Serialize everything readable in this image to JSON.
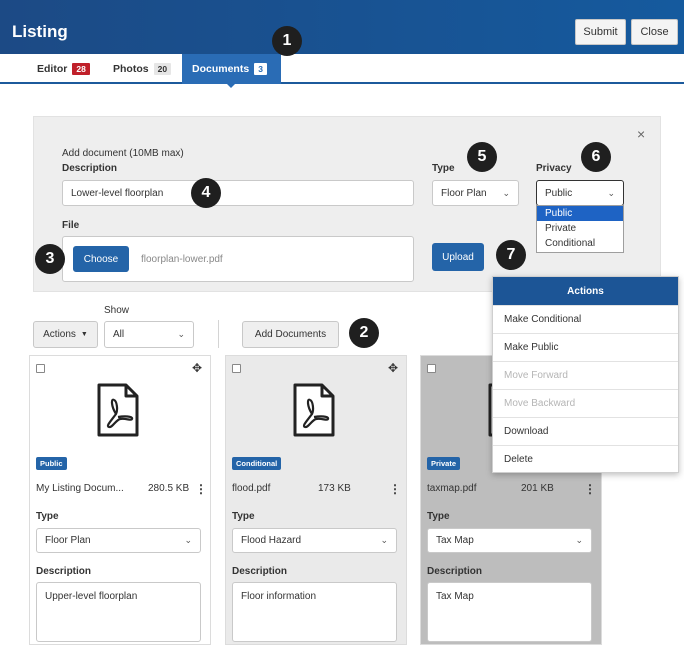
{
  "header": {
    "title": "Listing",
    "submit_label": "Submit",
    "close_label": "Close"
  },
  "tabs": [
    {
      "label": "Editor",
      "count": "28"
    },
    {
      "label": "Photos",
      "count": "20"
    },
    {
      "label": "Documents",
      "count": "3"
    }
  ],
  "callouts": [
    "1",
    "2",
    "3",
    "4",
    "5",
    "6",
    "7"
  ],
  "add_panel": {
    "close_glyph": "×",
    "heading": "Add document (10MB max)",
    "description_label": "Description",
    "description_value": "Lower-level floorplan",
    "file_label": "File",
    "choose_label": "Choose",
    "file_name": "floorplan-lower.pdf",
    "type_label": "Type",
    "type_value": "Floor Plan",
    "privacy_label": "Privacy",
    "privacy_value": "Public",
    "privacy_options": [
      "Public",
      "Private",
      "Conditional"
    ],
    "upload_label": "Upload"
  },
  "toolbar": {
    "show_label": "Show",
    "actions_label": "Actions",
    "show_value": "All",
    "add_documents_label": "Add Documents"
  },
  "actions_menu": {
    "title": "Actions",
    "items": [
      "Make Conditional",
      "Make Public",
      "Move Forward",
      "Move Backward",
      "Download",
      "Delete"
    ]
  },
  "documents": [
    {
      "badge": "Public",
      "name": "My Listing Docum...",
      "size": "280.5 KB",
      "type_label": "Type",
      "type": "Floor Plan",
      "desc_label": "Description",
      "description": "Upper-level floorplan"
    },
    {
      "badge": "Conditional",
      "name": "flood.pdf",
      "size": "173 KB",
      "type_label": "Type",
      "type": "Flood Hazard",
      "desc_label": "Description",
      "description": "Floor information"
    },
    {
      "badge": "Private",
      "name": "taxmap.pdf",
      "size": "201 KB",
      "type_label": "Type",
      "type": "Tax Map",
      "desc_label": "Description",
      "description": "Tax Map"
    }
  ],
  "colors": {
    "header_bg": "#1c4a85",
    "accent": "#2464a8",
    "selected_card_bg": "#bdbdbd",
    "tab_badge_red": "#c0202a"
  }
}
